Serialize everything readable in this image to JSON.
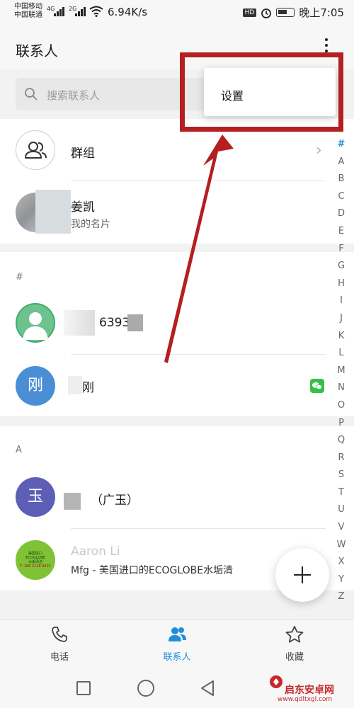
{
  "status_bar": {
    "carrier1": "中国移动",
    "carrier2": "中国联通",
    "net1": "4G",
    "net2": "2G",
    "speed": "6.94K/s",
    "hd": "HD",
    "time": "晚上7:05"
  },
  "header": {
    "title": "联系人"
  },
  "search": {
    "placeholder": "搜索联系人"
  },
  "menu": {
    "items": [
      {
        "label": "设置"
      }
    ]
  },
  "groups": {
    "label": "群组"
  },
  "profile": {
    "name": "姜凯",
    "subtitle": "我的名片"
  },
  "sections": [
    {
      "letter": "#",
      "contacts": [
        {
          "avatar_char": "",
          "name": "63930"
        },
        {
          "avatar_char": "刚",
          "name": "刚",
          "has_wechat": true
        }
      ]
    },
    {
      "letter": "A",
      "contacts": [
        {
          "avatar_char": "玉",
          "name": "（广玉）"
        },
        {
          "avatar_char": "",
          "name": "Aaron Li",
          "subtitle": "Mfg - 美国进口的ECOGLOBE水垢清"
        }
      ]
    }
  ],
  "alphabet_index": [
    "#",
    "A",
    "B",
    "C",
    "D",
    "E",
    "F",
    "G",
    "H",
    "I",
    "J",
    "K",
    "L",
    "M",
    "N",
    "O",
    "P",
    "Q",
    "R",
    "S",
    "T",
    "U",
    "V",
    "W",
    "X",
    "Y",
    "Z"
  ],
  "tabs": [
    {
      "label": "电话",
      "icon": "phone-icon",
      "active": false
    },
    {
      "label": "联系人",
      "icon": "contacts-icon",
      "active": true
    },
    {
      "label": "收藏",
      "icon": "star-icon",
      "active": false
    }
  ],
  "aaron_logo": {
    "line1": "美国进口",
    "line2": "ECOGLOBE",
    "line3": "水垢清洁",
    "line4": "T: 186 2118 9621"
  },
  "watermark": {
    "brand": "启东安卓网",
    "url": "www.qdltxgl.com"
  },
  "colors": {
    "accent": "#1f8fdc",
    "annotation_red": "#b51f1f",
    "wechat_green": "#35c146"
  }
}
